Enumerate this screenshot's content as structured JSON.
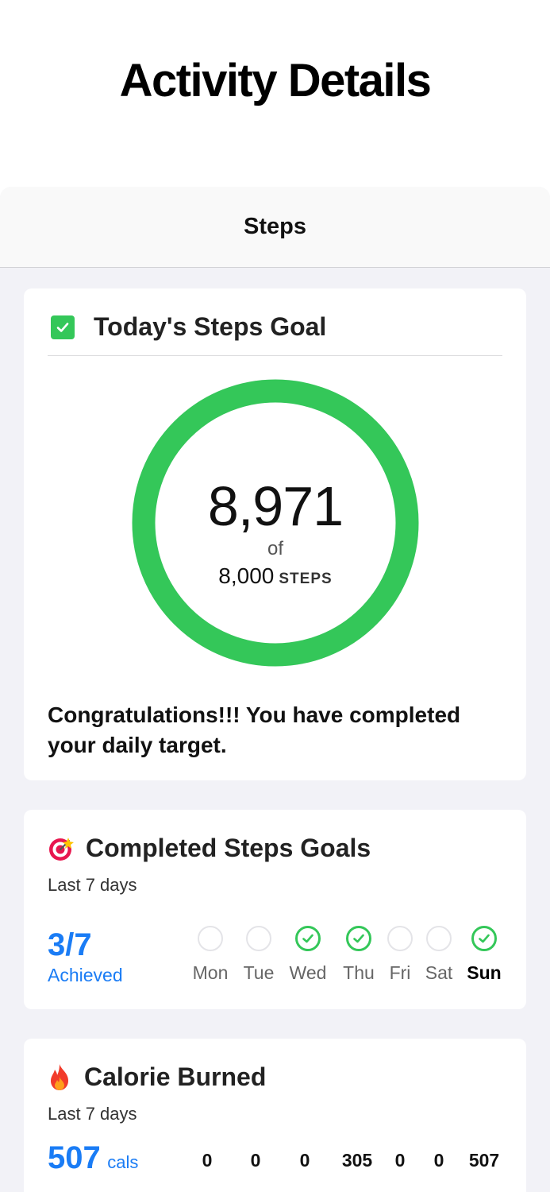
{
  "page_title": "Activity Details",
  "sheet_title": "Steps",
  "goal_card": {
    "heading": "Today's Steps Goal",
    "steps_value": "8,971",
    "of_label": "of",
    "goal_value": "8,000",
    "goal_unit": "STEPS",
    "progress": 1.0,
    "ring_color": "#34c759",
    "message": "Congratulations!!! You have completed your daily target."
  },
  "completed_card": {
    "heading": "Completed Steps Goals",
    "subtitle": "Last 7 days",
    "achieved_value": "3/7",
    "achieved_label": "Achieved",
    "days": [
      {
        "label": "Mon",
        "done": false,
        "today": false
      },
      {
        "label": "Tue",
        "done": false,
        "today": false
      },
      {
        "label": "Wed",
        "done": true,
        "today": false
      },
      {
        "label": "Thu",
        "done": true,
        "today": false
      },
      {
        "label": "Fri",
        "done": false,
        "today": false
      },
      {
        "label": "Sat",
        "done": false,
        "today": false
      },
      {
        "label": "Sun",
        "done": true,
        "today": true
      }
    ]
  },
  "calorie_card": {
    "heading": "Calorie Burned",
    "subtitle": "Last 7 days",
    "total_value": "507",
    "total_unit": "cals",
    "daily_values": [
      "0",
      "0",
      "0",
      "305",
      "0",
      "0",
      "507"
    ]
  },
  "colors": {
    "accent_blue": "#1a7cf5",
    "success_green": "#34c759"
  }
}
